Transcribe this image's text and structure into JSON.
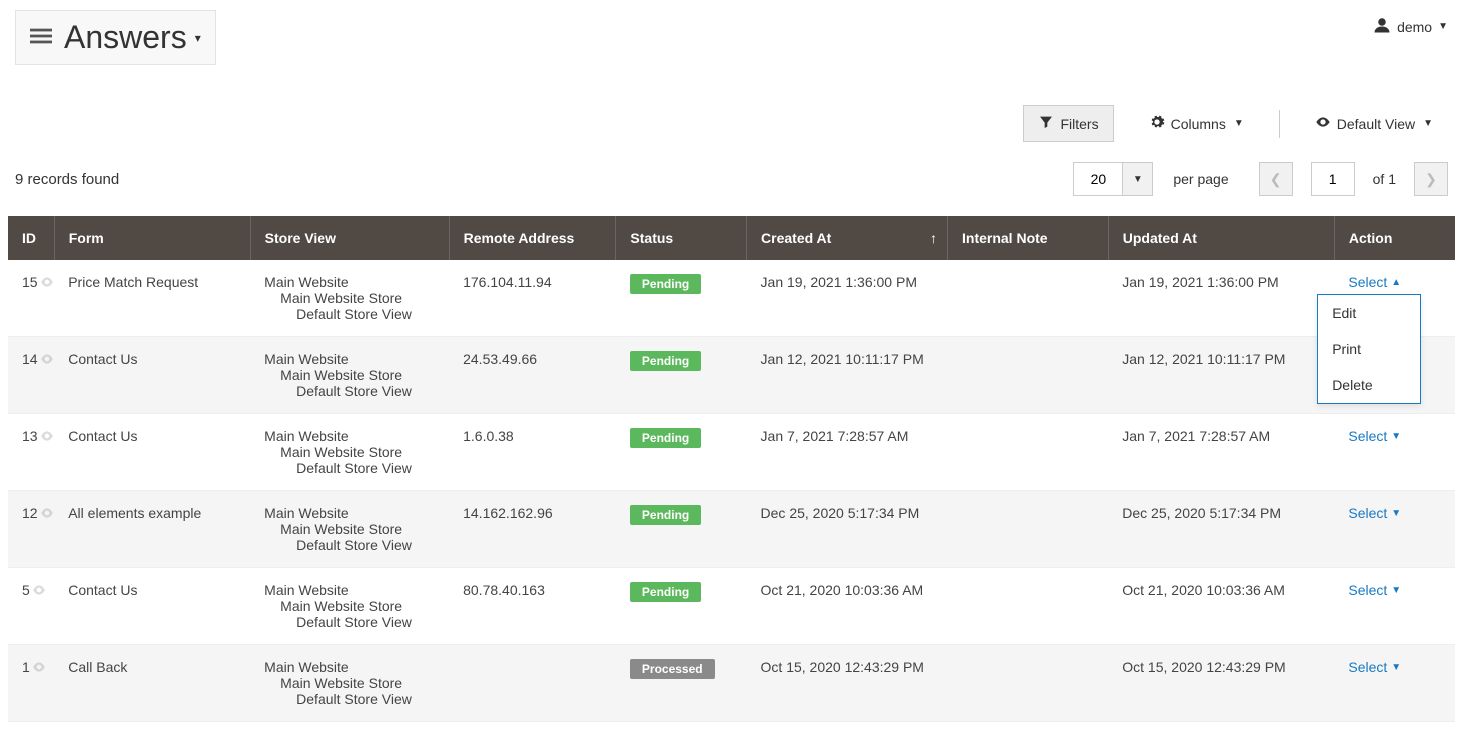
{
  "header": {
    "title": "Answers",
    "user": "demo"
  },
  "toolbar": {
    "filters": "Filters",
    "columns": "Columns",
    "default_view": "Default View"
  },
  "controls": {
    "records_found": "9 records found",
    "per_page_value": "20",
    "per_page_label": "per page",
    "current_page": "1",
    "total_pages": "of 1"
  },
  "columns": {
    "id": "ID",
    "form": "Form",
    "store": "Store View",
    "remote": "Remote Address",
    "status": "Status",
    "created": "Created At",
    "note": "Internal Note",
    "updated": "Updated At",
    "action": "Action"
  },
  "store_hierarchy": {
    "l1": "Main Website",
    "l2": "Main Website Store",
    "l3": "Default Store View"
  },
  "status_labels": {
    "pending": "Pending",
    "processed": "Processed"
  },
  "action": {
    "select": "Select",
    "edit": "Edit",
    "print": "Print",
    "delete": "Delete"
  },
  "rows": [
    {
      "id": "15",
      "form": "Price Match Request",
      "remote": "176.104.11.94",
      "status": "pending",
      "created": "Jan 19, 2021 1:36:00 PM",
      "note": "",
      "updated": "Jan 19, 2021 1:36:00 PM",
      "open": true
    },
    {
      "id": "14",
      "form": "Contact Us",
      "remote": "24.53.49.66",
      "status": "pending",
      "created": "Jan 12, 2021 10:11:17 PM",
      "note": "",
      "updated": "Jan 12, 2021 10:11:17 PM",
      "open": false
    },
    {
      "id": "13",
      "form": "Contact Us",
      "remote": "1.6.0.38",
      "status": "pending",
      "created": "Jan 7, 2021 7:28:57 AM",
      "note": "",
      "updated": "Jan 7, 2021 7:28:57 AM",
      "open": false
    },
    {
      "id": "12",
      "form": "All elements example",
      "remote": "14.162.162.96",
      "status": "pending",
      "created": "Dec 25, 2020 5:17:34 PM",
      "note": "",
      "updated": "Dec 25, 2020 5:17:34 PM",
      "open": false
    },
    {
      "id": "5",
      "form": "Contact Us",
      "remote": "80.78.40.163",
      "status": "pending",
      "created": "Oct 21, 2020 10:03:36 AM",
      "note": "",
      "updated": "Oct 21, 2020 10:03:36 AM",
      "open": false
    },
    {
      "id": "1",
      "form": "Call Back",
      "remote": "",
      "status": "processed",
      "created": "Oct 15, 2020 12:43:29 PM",
      "note": "",
      "updated": "Oct 15, 2020 12:43:29 PM",
      "open": false
    }
  ]
}
